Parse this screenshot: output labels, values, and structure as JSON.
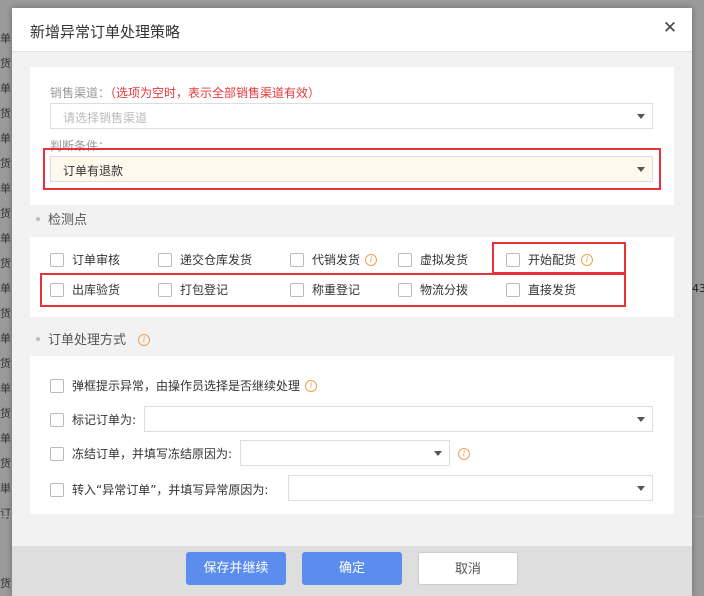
{
  "background": {
    "left_fragments": [
      "单",
      "货",
      "单",
      "货",
      "单",
      "货",
      "单",
      "货",
      "单",
      "货",
      "单",
      "货",
      "单",
      "货",
      "单",
      "货",
      "单",
      "货",
      "単",
      "订",
      "货"
    ],
    "right_fragment": "43"
  },
  "dialog": {
    "title": "新增异常订单处理策略",
    "close_icon": "close-icon"
  },
  "channel": {
    "label": "销售渠道：",
    "note": "（选项为空时，表示全部销售渠道有效）",
    "placeholder": "请选择销售渠道"
  },
  "condition": {
    "label": "判断条件：",
    "value": "订单有退款"
  },
  "checkpoints": {
    "title": "检测点",
    "items": [
      {
        "label": "订单审核",
        "info": false
      },
      {
        "label": "递交仓库发货",
        "info": false
      },
      {
        "label": "代销发货",
        "info": true
      },
      {
        "label": "虚拟发货",
        "info": false
      },
      {
        "label": "开始配货",
        "info": true
      },
      {
        "label": "出库验货",
        "info": false
      },
      {
        "label": "打包登记",
        "info": false
      },
      {
        "label": "称重登记",
        "info": false
      },
      {
        "label": "物流分拨",
        "info": false
      },
      {
        "label": "直接发货",
        "info": false
      }
    ]
  },
  "handling": {
    "title": "订单处理方式",
    "opt1": "弹框提示异常，由操作员选择是否继续处理",
    "opt2": "标记订单为:",
    "opt3": "冻结订单，并填写冻结原因为:",
    "opt4": "转入“异常订单”，并填写异常原因为:"
  },
  "buttons": {
    "save_continue": "保存并继续",
    "ok": "确定",
    "cancel": "取消"
  },
  "colors": {
    "primary": "#5b8def",
    "highlight": "#e8323a",
    "note": "#e4393c",
    "info": "#f0a050"
  }
}
